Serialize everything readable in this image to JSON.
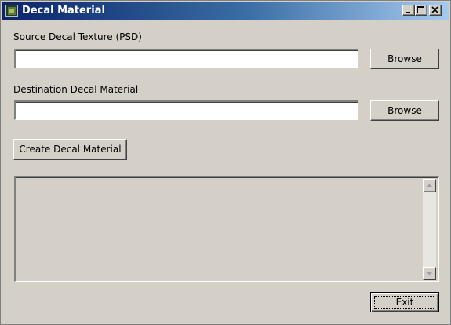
{
  "window": {
    "title": "Decal Material",
    "icon": "app-icon",
    "controls": [
      "minimize-icon",
      "maximize-icon",
      "close-icon"
    ]
  },
  "source": {
    "label": "Source Decal Texture (PSD)",
    "value": "",
    "browse_label": "Browse"
  },
  "destination": {
    "label": "Destination Decal Material",
    "value": "",
    "browse_label": "Browse"
  },
  "create_label": "Create Decal Material",
  "output": {
    "text": ""
  },
  "exit_label": "Exit",
  "colors": {
    "title_gradient_start": "#0a246a",
    "title_gradient_end": "#a6caf0",
    "face": "#d4d0c8"
  }
}
